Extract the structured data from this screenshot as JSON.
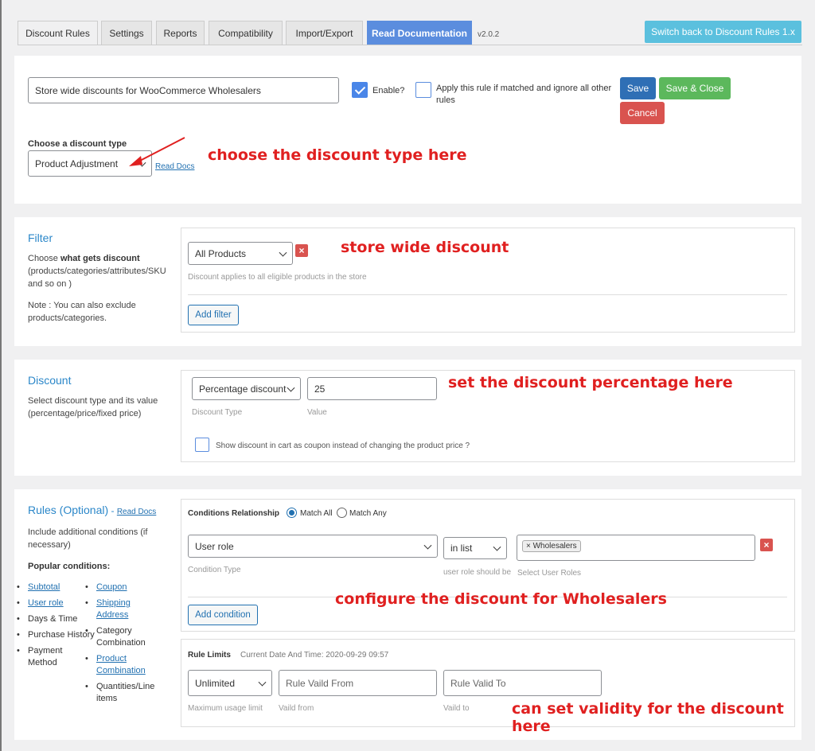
{
  "tabs": [
    {
      "label": "Discount Rules"
    },
    {
      "label": "Settings"
    },
    {
      "label": "Reports"
    },
    {
      "label": "Compatibility"
    },
    {
      "label": "Import/Export"
    },
    {
      "label": "Read Documentation"
    }
  ],
  "version": "v2.0.2",
  "switch_button": "Switch back to Discount Rules 1.x",
  "rule": {
    "name_value": "Store wide discounts for WooCommerce Wholesalers",
    "enable_label": "Enable?",
    "enable_checked": true,
    "exclusive_label": "Apply this rule if matched and ignore all other rules",
    "save": "Save",
    "save_close": "Save & Close",
    "cancel": "Cancel",
    "discount_type_label": "Choose a discount type",
    "discount_type_value": "Product Adjustment",
    "read_docs": "Read Docs"
  },
  "filter": {
    "title": "Filter",
    "desc_prefix": "Choose ",
    "desc_bold": "what gets discount",
    "desc_rest": "(products/categories/attributes/SKU and so on )",
    "note": "Note : You can also exclude products/categories.",
    "select_value": "All Products",
    "hint": "Discount applies to all eligible products in the store",
    "add_filter": "Add filter"
  },
  "discount": {
    "title": "Discount",
    "desc": "Select discount type and its value (percentage/price/fixed price)",
    "type_value": "Percentage discount",
    "value": "25",
    "type_hint": "Discount Type",
    "value_hint": "Value",
    "coupon_label": "Show discount in cart as coupon instead of changing the product price ?"
  },
  "rules": {
    "title": "Rules (Optional)",
    "sep": " - ",
    "read_docs": "Read Docs",
    "desc": "Include additional conditions (if necessary)",
    "popular_label": "Popular conditions:",
    "popular_col1": [
      "Subtotal",
      "User role",
      "Days & Time",
      "Purchase History",
      "Payment Method"
    ],
    "popular_col2": [
      "Coupon",
      "Shipping Address",
      "Category Combination",
      "Product Combination",
      "Quantities/Line items"
    ],
    "relationship_label": "Conditions Relationship",
    "match_all": "Match All",
    "match_any": "Match Any",
    "condition_type_value": "User role",
    "condition_type_hint": "Condition Type",
    "operator_value": "in list",
    "operator_hint": "user role should be",
    "roles_tag": "× Wholesalers",
    "roles_hint": "Select User Roles",
    "add_condition": "Add condition",
    "limits_label": "Rule Limits",
    "current_date": "Current Date And Time: 2020-09-29 09:57",
    "usage_value": "Unlimited",
    "usage_hint": "Maximum usage limit",
    "valid_from_placeholder": "Rule Vaild From",
    "valid_from_hint": "Vaild from",
    "valid_to_placeholder": "Rule Valid To",
    "valid_to_hint": "Vaild to"
  },
  "annotations": {
    "discount_type": "choose the discount type here",
    "store_wide": "store wide discount",
    "percentage": "set the discount percentage here",
    "wholesalers": "configure the discount for Wholesalers",
    "validity_1": "can set validity for the discount",
    "validity_2": "here"
  },
  "colors": {
    "annotation": "#e02020",
    "accent": "#2b87c9",
    "save": "#2f6fb5",
    "save_close": "#5cb85c",
    "cancel": "#d9534f",
    "switch": "#5bc0de"
  }
}
